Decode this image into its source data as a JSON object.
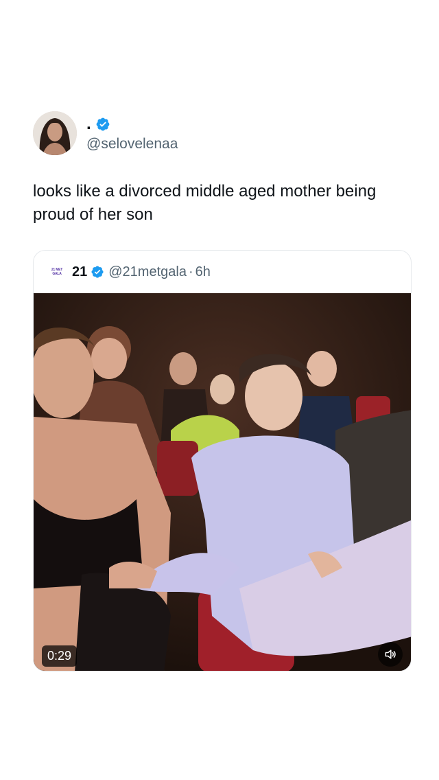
{
  "tweet": {
    "author": {
      "display_name": ".",
      "handle": "@selovelenaa",
      "verified": true,
      "avatar_icon": "profile-photo"
    },
    "text": "looks like a divorced middle aged mother being proud of her son"
  },
  "quoted_tweet": {
    "logo_text": "21 MET GALA",
    "display_name": "21",
    "verified": true,
    "handle": "@21metgala",
    "separator": "·",
    "time": "6h",
    "video": {
      "duration": "0:29",
      "sound_icon": "volume-icon"
    }
  },
  "colors": {
    "verified_blue": "#1d9bf0",
    "text_primary": "#0f1419",
    "text_secondary": "#536471"
  }
}
